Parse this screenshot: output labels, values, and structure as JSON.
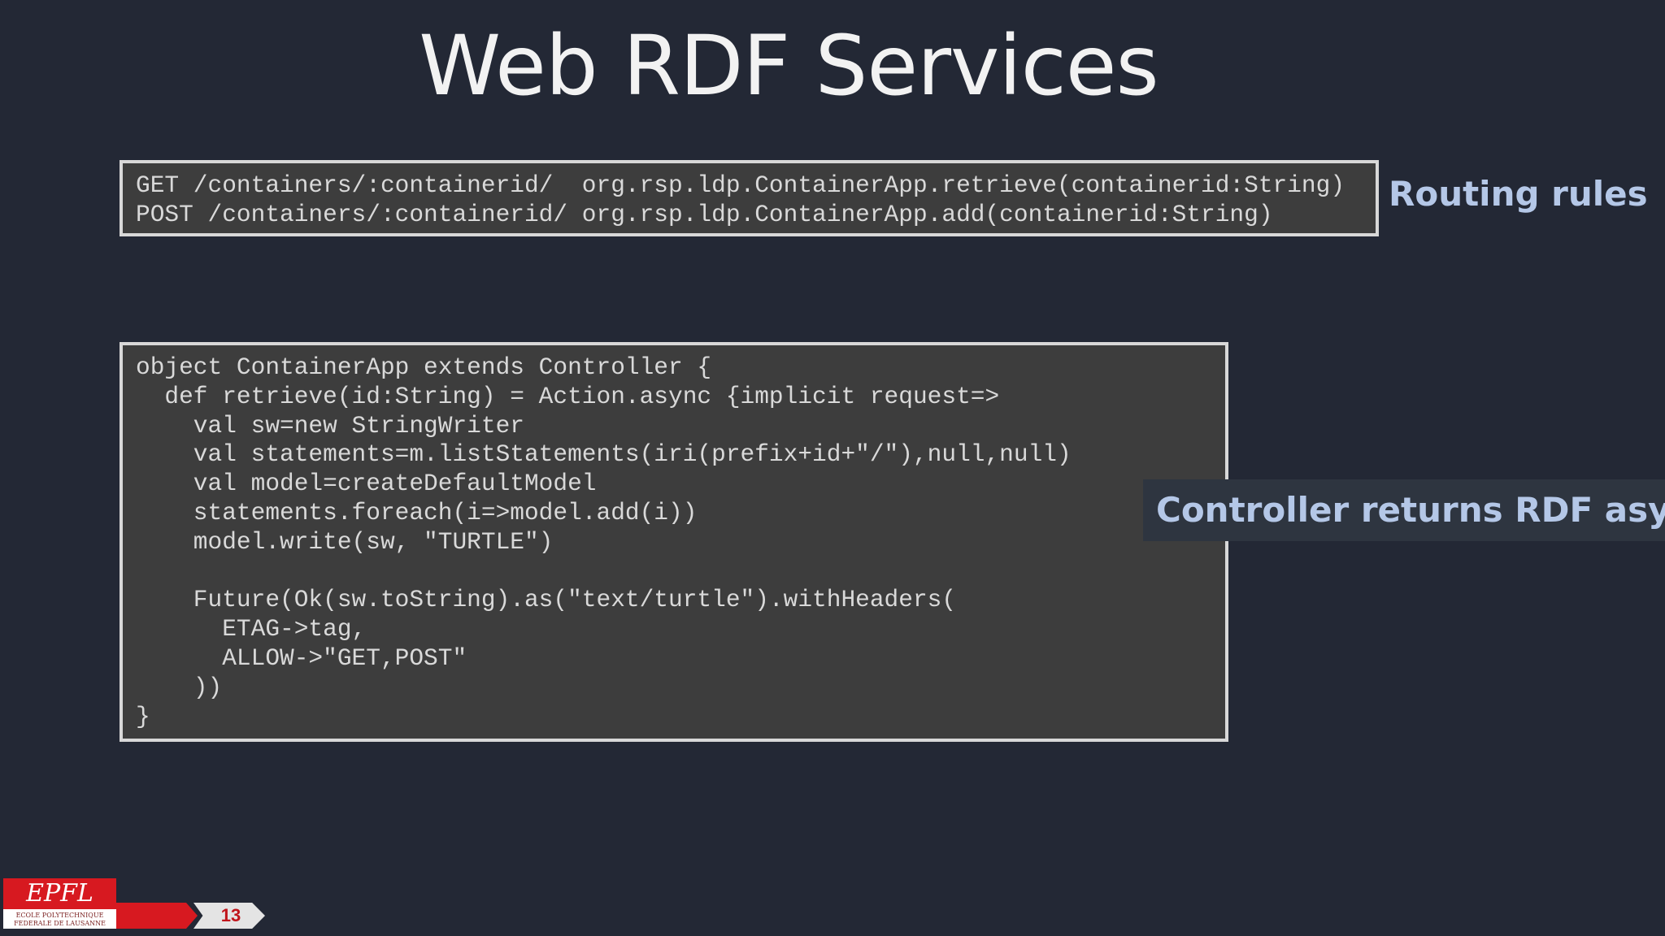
{
  "slide": {
    "title": "Web RDF Services",
    "page_number": "13"
  },
  "routes_code": [
    "GET /containers/:containerid/  org.rsp.ldp.ContainerApp.retrieve(containerid:String)",
    "POST /containers/:containerid/ org.rsp.ldp.ContainerApp.add(containerid:String)"
  ],
  "controller_code": [
    "object ContainerApp extends Controller {",
    "  def retrieve(id:String) = Action.async {implicit request=>",
    "    val sw=new StringWriter",
    "    val statements=m.listStatements(iri(prefix+id+\"/\"),null,null)",
    "    val model=createDefaultModel",
    "    statements.foreach(i=>model.add(i))",
    "    model.write(sw, \"TURTLE\")",
    "",
    "    Future(Ok(sw.toString).as(\"text/turtle\").withHeaders(",
    "      ETAG->tag,",
    "      ALLOW->\"GET,POST\"",
    "    ))",
    "}"
  ],
  "callouts": {
    "routing": "Routing rules",
    "controller": "Controller returns RDF async"
  },
  "logo": {
    "mark": "EPFL",
    "line1": "ÉCOLE POLYTECHNIQUE",
    "line2": "FÉDÉRALE DE LAUSANNE"
  },
  "colors": {
    "background": "#232835",
    "code_background": "#3d3d3d",
    "code_border": "#d8d8d8",
    "code_text": "#d9d9d9",
    "callout_text": "#b4c7e7",
    "brand_red": "#d71920"
  }
}
